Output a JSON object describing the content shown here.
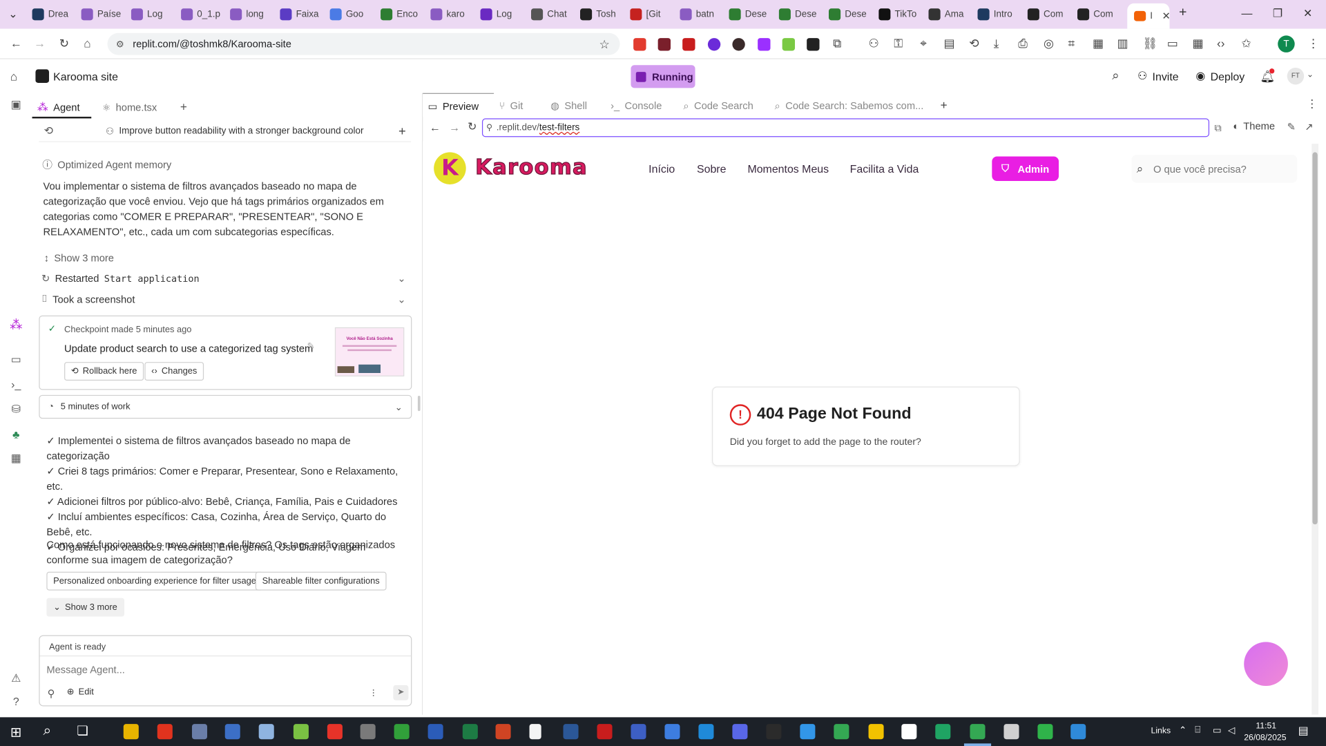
{
  "browser": {
    "tabs": [
      {
        "label": "Drea",
        "color": "#1e3a5f"
      },
      {
        "label": "Paíse",
        "color": "#8a5cc2"
      },
      {
        "label": "Log",
        "color": "#8a5cc2"
      },
      {
        "label": "0_1.p",
        "color": "#8a5cc2"
      },
      {
        "label": "long",
        "color": "#8a5cc2"
      },
      {
        "label": "Faixa",
        "color": "#5b3cc4"
      },
      {
        "label": "Goo",
        "color": "#4b7be5"
      },
      {
        "label": "Enco",
        "color": "#2e7d32"
      },
      {
        "label": "karo",
        "color": "#8a5cc2"
      },
      {
        "label": "Log",
        "color": "#6a2ac2"
      },
      {
        "label": "Chat",
        "color": "#555555"
      },
      {
        "label": "Tosh",
        "color": "#222222"
      },
      {
        "label": "[Git",
        "color": "#c5221f"
      },
      {
        "label": "batn",
        "color": "#8a5cc2"
      },
      {
        "label": "Dese",
        "color": "#2e7d32"
      },
      {
        "label": "Dese",
        "color": "#2e7d32"
      },
      {
        "label": "Dese",
        "color": "#2e7d32"
      },
      {
        "label": "TikTo",
        "color": "#111111"
      },
      {
        "label": "Ama",
        "color": "#333333"
      },
      {
        "label": "Intro",
        "color": "#1e3a5f"
      },
      {
        "label": "Com",
        "color": "#222222"
      },
      {
        "label": "Com",
        "color": "#222222"
      }
    ],
    "active_tab_label": "I",
    "url": "replit.com/@toshmk8/Karooma-site",
    "accent": "#ecd9f3"
  },
  "replit": {
    "project_name": "Karooma site",
    "run_status": "Running",
    "invite_label": "Invite",
    "deploy_label": "Deploy",
    "avatar_initials": "FT",
    "profile_initial": "T"
  },
  "agent": {
    "tabs": {
      "agent": "Agent",
      "file": "home.tsx"
    },
    "history_title": "Improve button readability with a stronger background color",
    "memory_label": "Optimized Agent memory",
    "intro_text": "Vou implementar o sistema de filtros avançados baseado no mapa de categorização que você enviou. Vejo que há tags primários organizados em categorias como \"COMER E PREPARAR\", \"PRESENTEAR\", \"SONO E RELAXAMENTO\", etc., cada um com subcategorias específicas.",
    "show_more_1": "Show 3 more",
    "restarted_label": "Restarted",
    "restarted_code": "Start application",
    "screenshot_label": "Took a screenshot",
    "checkpoint": {
      "meta": "Checkpoint made 5 minutes ago",
      "title": "Update product search to use a categorized tag system",
      "rollback": "Rollback here",
      "changes": "Changes",
      "thumb_text": "Você Não Está Sozinha"
    },
    "work_label": "5 minutes of work",
    "summary": [
      "✓ Implementei o sistema de filtros avançados baseado no mapa de categorização",
      "✓ Criei 8 tags primários: Comer e Preparar, Presentear, Sono e Relaxamento, etc.",
      "✓ Adicionei filtros por público-alvo: Bebê, Criança, Família, Pais e Cuidadores",
      "✓ Incluí ambientes específicos: Casa, Cozinha, Área de Serviço, Quarto do Bebê, etc.",
      "✓ Organizei por ocasiões: Presentes, Emergência, Uso Diário, Viagem"
    ],
    "question": "Como está funcionando o novo sistema de filtros? Os tags estão organizados conforme sua imagem de categorização?",
    "suggestions": [
      "Personalized onboarding experience for filter usage",
      "Shareable filter configurations"
    ],
    "show_more_2": "Show 3 more",
    "status": "Agent is ready",
    "input_placeholder": "Message Agent...",
    "edit_label": "Edit"
  },
  "workspace": {
    "tabs": [
      "Preview",
      "Git",
      "Shell",
      "Console",
      "Code Search",
      "Code Search: Sabemos com..."
    ],
    "url_prefix": ".replit.dev/",
    "url_path": "test-filters",
    "theme_label": "Theme"
  },
  "site": {
    "logo_letter": "K",
    "brand": "Karooma",
    "nav": [
      "Início",
      "Sobre",
      "Momentos Meus",
      "Facilita a Vida"
    ],
    "admin_label": "Admin",
    "search_placeholder": "O que você precisa?",
    "error_title": "404 Page Not Found",
    "error_body": "Did you forget to add the page to the router?",
    "brand_color": "#e91ee3",
    "logo_yellow": "#e6e02a"
  },
  "taskbar": {
    "links_label": "Links",
    "time": "11:51",
    "date": "26/08/2025"
  }
}
